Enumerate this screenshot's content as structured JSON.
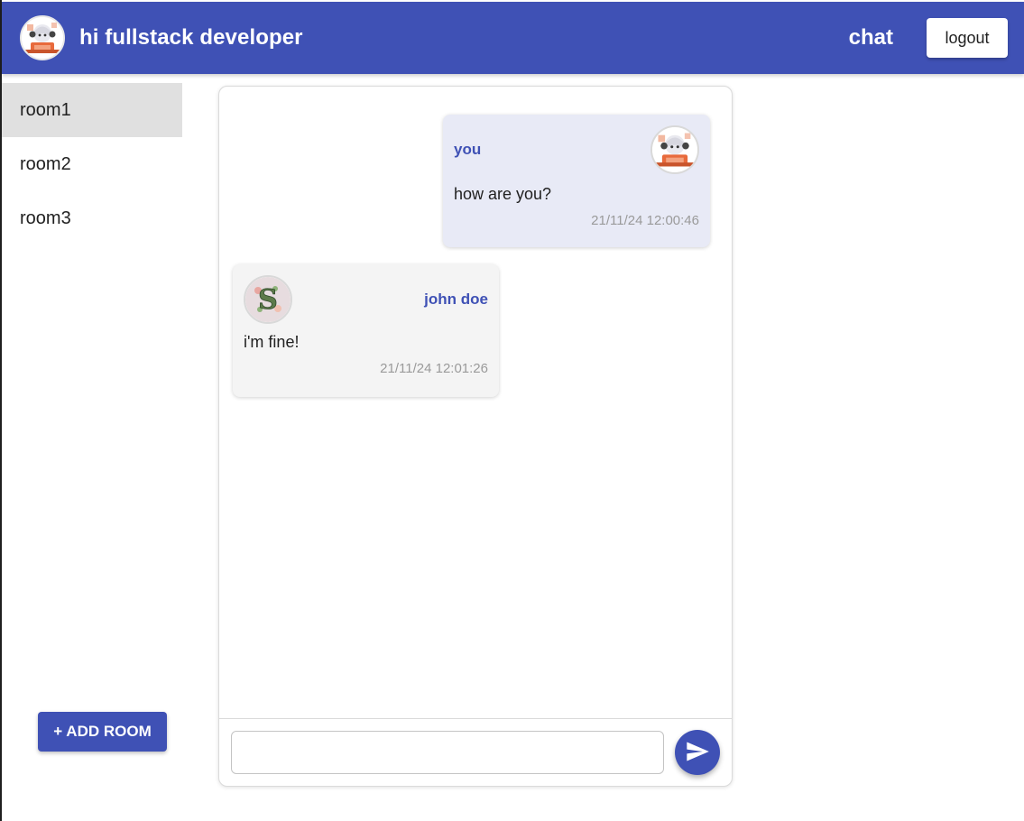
{
  "header": {
    "greeting": "hi fullstack developer",
    "nav_chat": "chat",
    "logout_label": "logout",
    "avatar_icon": "anime-user-avatar-icon"
  },
  "sidebar": {
    "rooms": [
      {
        "label": "room1",
        "active": true
      },
      {
        "label": "room2",
        "active": false
      },
      {
        "label": "room3",
        "active": false
      }
    ],
    "add_room_label": "+ ADD ROOM"
  },
  "chat": {
    "messages": [
      {
        "sender": "you",
        "text": "how are you?",
        "timestamp": "21/11/24 12:00:46",
        "avatar_icon": "anime-user-avatar-icon"
      },
      {
        "sender": "john doe",
        "text": "i'm fine!",
        "timestamp": "21/11/24 12:01:26",
        "avatar_icon": "floral-letter-s-avatar-icon"
      }
    ],
    "composer": {
      "value": "",
      "placeholder": ""
    },
    "send_icon": "send-icon"
  },
  "colors": {
    "primary": "#3f51b5",
    "own_bubble": "#e8eaf6",
    "other_bubble": "#f4f4f4",
    "active_room": "#e0e0e0"
  }
}
